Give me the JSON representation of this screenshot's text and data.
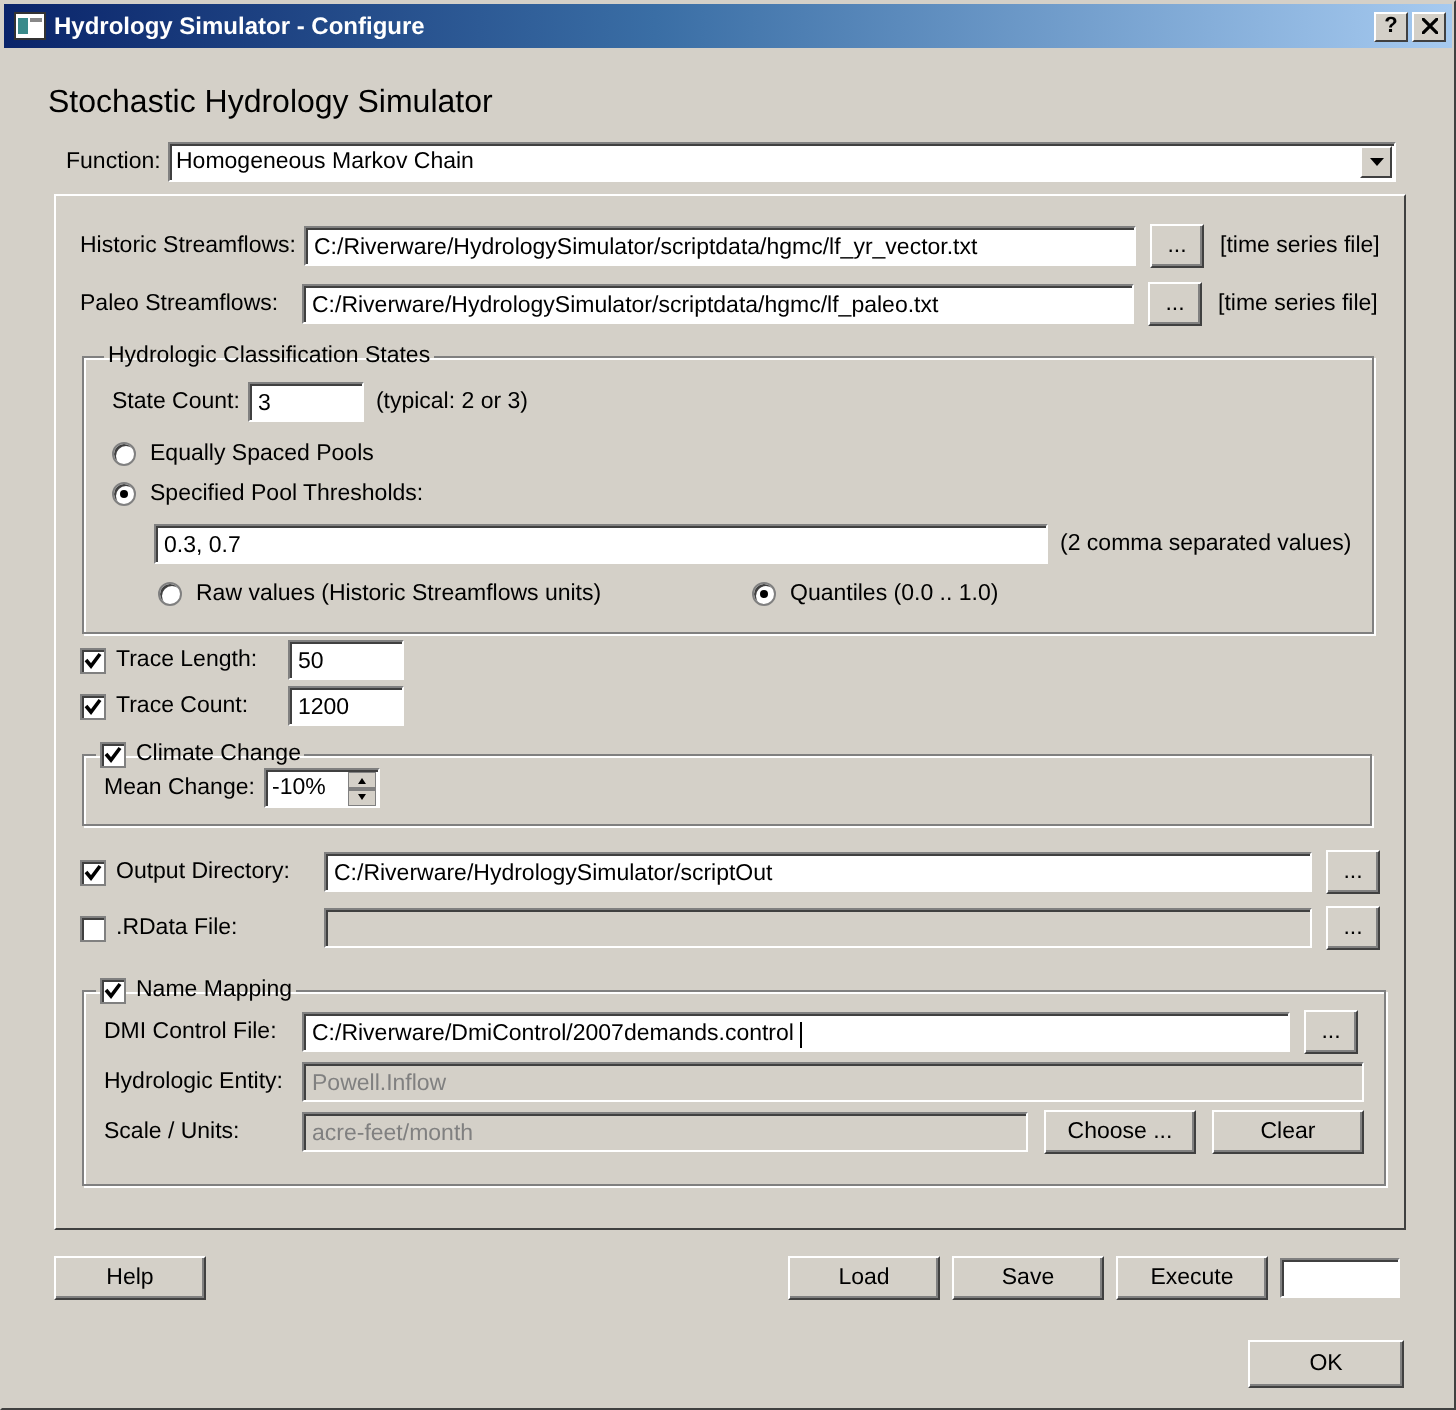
{
  "window": {
    "title": "Hydrology Simulator - Configure",
    "help_button": "?"
  },
  "heading": "Stochastic Hydrology Simulator",
  "function": {
    "label": "Function:",
    "value": "Homogeneous Markov Chain"
  },
  "streamflows": [
    {
      "label": "Historic Streamflows:",
      "value": "C:/Riverware/HydrologySimulator/scriptdata/hgmc/lf_yr_vector.txt",
      "browse": "...",
      "hint": "[time series file]"
    },
    {
      "label": "Paleo Streamflows:",
      "value": "C:/Riverware/HydrologySimulator/scriptdata/hgmc/lf_paleo.txt",
      "browse": "...",
      "hint": "[time series file]"
    }
  ],
  "classification": {
    "title": "Hydrologic Classification States",
    "state_count": {
      "label": "State Count:",
      "value": "3",
      "hint": "(typical: 2 or 3)"
    },
    "pool_options": [
      {
        "label": "Equally Spaced Pools",
        "selected": false
      },
      {
        "label": "Specified Pool Thresholds:",
        "selected": true
      }
    ],
    "thresholds": {
      "value": "0.3, 0.7",
      "hint": "(2 comma separated values)"
    },
    "units": [
      {
        "label": "Raw values (Historic Streamflows units)",
        "selected": false
      },
      {
        "label": "Quantiles (0.0 .. 1.0)",
        "selected": true
      }
    ]
  },
  "traces": [
    {
      "label": "Trace Length:",
      "checked": true,
      "value": "50"
    },
    {
      "label": "Trace Count:",
      "checked": true,
      "value": "1200"
    }
  ],
  "climate": {
    "title": "Climate Change",
    "checked": true,
    "mean_change": {
      "label": "Mean Change:",
      "value": "-10%"
    }
  },
  "outputs": [
    {
      "label": "Output Directory:",
      "checked": true,
      "value": "C:/Riverware/HydrologySimulator/scriptOut",
      "browse": "..."
    },
    {
      "label": ".RData File:",
      "checked": false,
      "browse": "..."
    }
  ],
  "name_mapping": {
    "title": "Name Mapping",
    "checked": true,
    "rows": [
      {
        "kind": "browse",
        "label": "DMI Control File:",
        "value": "C:/Riverware/DmiControl/2007demands.control",
        "disabled": false,
        "browse": "..."
      },
      {
        "kind": "plain",
        "label": "Hydrologic Entity:",
        "value": "Powell.Inflow",
        "disabled": true
      },
      {
        "kind": "units",
        "label": "Scale / Units:",
        "value": "acre-feet/month",
        "disabled": true,
        "buttons": [
          "Choose ...",
          "Clear"
        ]
      }
    ]
  },
  "footer": {
    "left": [
      "Help"
    ],
    "right": [
      "Load",
      "Save",
      "Execute"
    ],
    "ok": "OK"
  }
}
